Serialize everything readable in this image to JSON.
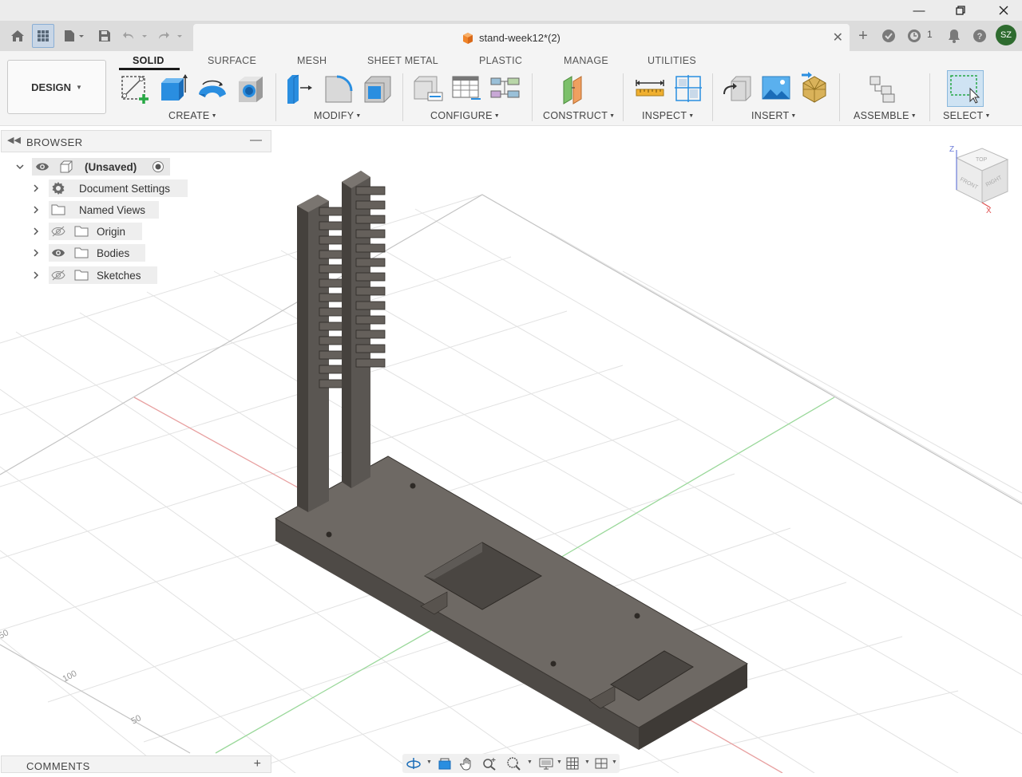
{
  "window": {
    "title": "stand-week12*(2)",
    "controls": [
      "minimize-icon",
      "restore-icon",
      "close-icon"
    ]
  },
  "quick_access": {
    "job_count": "1",
    "user_initials": "SZ",
    "icons": [
      "home-icon",
      "data-panel-icon",
      "file-icon",
      "save-icon",
      "undo-icon",
      "redo-icon",
      "new-tab-icon",
      "extensions-icon",
      "job-status-icon",
      "notifications-icon",
      "help-icon"
    ]
  },
  "toolbar": {
    "workspace": "DESIGN",
    "tabs": [
      {
        "label": "SOLID",
        "active": true
      },
      {
        "label": "SURFACE",
        "active": false
      },
      {
        "label": "MESH",
        "active": false
      },
      {
        "label": "SHEET METAL",
        "active": false
      },
      {
        "label": "PLASTIC",
        "active": false
      },
      {
        "label": "MANAGE",
        "active": false
      },
      {
        "label": "UTILITIES",
        "active": false
      }
    ],
    "groups": [
      {
        "label": "CREATE"
      },
      {
        "label": "MODIFY"
      },
      {
        "label": "CONFIGURE"
      },
      {
        "label": "CONSTRUCT"
      },
      {
        "label": "INSPECT"
      },
      {
        "label": "INSERT"
      },
      {
        "label": "ASSEMBLE"
      },
      {
        "label": "SELECT"
      }
    ]
  },
  "browser": {
    "title": "BROWSER",
    "root": "(Unsaved)",
    "items": [
      {
        "label": "Document Settings",
        "icon": "gear-icon"
      },
      {
        "label": "Named Views",
        "icon": "folder-icon"
      },
      {
        "label": "Origin",
        "icon": "folder-icon",
        "visible": false
      },
      {
        "label": "Bodies",
        "icon": "folder-icon",
        "visible": true
      },
      {
        "label": "Sketches",
        "icon": "folder-icon",
        "visible": false
      }
    ]
  },
  "viewcube": {
    "faces": [
      "TOP",
      "FRONT",
      "RIGHT"
    ],
    "axes": [
      "Z",
      "X"
    ]
  },
  "grid_labels": [
    "50",
    "100",
    "50"
  ],
  "comments": {
    "title": "COMMENTS"
  },
  "colors": {
    "accent_blue": "#1a8cd8",
    "body_dark": "#5e5a56",
    "body_light": "#7a7570",
    "grid_line": "#dddddd",
    "axis_red": "#e88a8a",
    "axis_green": "#8ad48a",
    "avatar_green": "#2e6b2f"
  }
}
